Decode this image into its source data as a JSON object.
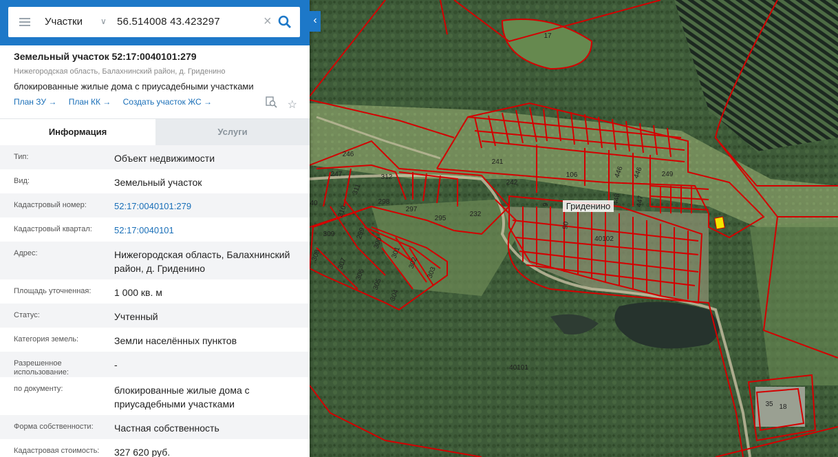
{
  "search": {
    "layer": "Участки",
    "query": "56.514008 43.423297"
  },
  "parcel": {
    "title": "Земельный участок 52:17:0040101:279",
    "address_short": "Нижегородская область, Балахнинский район, д. Гриденино",
    "purpose": "блокированные жилые дома с приусадебными участками",
    "links": [
      "План ЗУ →",
      "План КК →",
      "Создать участок ЖС →"
    ]
  },
  "tabs": [
    "Информация",
    "Услуги"
  ],
  "rows": [
    {
      "key": "Тип:",
      "value": "Объект недвижимости"
    },
    {
      "key": "Вид:",
      "value": "Земельный участок"
    },
    {
      "key": "Кадастровый номер:",
      "value": "52:17:0040101:279",
      "link": true
    },
    {
      "key": "Кадастровый квартал:",
      "value": "52:17:0040101",
      "link": true
    },
    {
      "key": "Адрес:",
      "value": "Нижегородская область, Балахнинский район, д. Гриденино"
    },
    {
      "key": "Площадь уточненная:",
      "value": "1 000 кв. м"
    },
    {
      "key": "Статус:",
      "value": "Учтенный"
    },
    {
      "key": "Категория земель:",
      "value": "Земли населённых пунктов"
    },
    {
      "key": "Разрешенное использование:",
      "value": "-"
    },
    {
      "key": "по документу:",
      "value": "блокированные жилые дома с приусадебными участками"
    },
    {
      "key": "Форма собственности:",
      "value": "Частная собственность"
    },
    {
      "key": "Кадастровая стоимость:",
      "value": "327 620 руб."
    }
  ],
  "map": {
    "village": "Гриденино",
    "quarters": [
      "40102",
      "40101"
    ],
    "parcels": [
      "17",
      "246",
      "247",
      "312",
      "311",
      "310",
      "298",
      "297",
      "295",
      "232",
      "241",
      "242",
      "106",
      "446",
      "446",
      "249",
      "448",
      "447",
      "9",
      "90",
      "309",
      "299",
      "300",
      "301",
      "302",
      "303",
      "308",
      "307",
      "306",
      "305",
      "304",
      "40",
      "35",
      "18"
    ]
  },
  "colors": {
    "accent": "#1d78c8",
    "boundary": "#d40000",
    "selected": "#f2e600"
  }
}
